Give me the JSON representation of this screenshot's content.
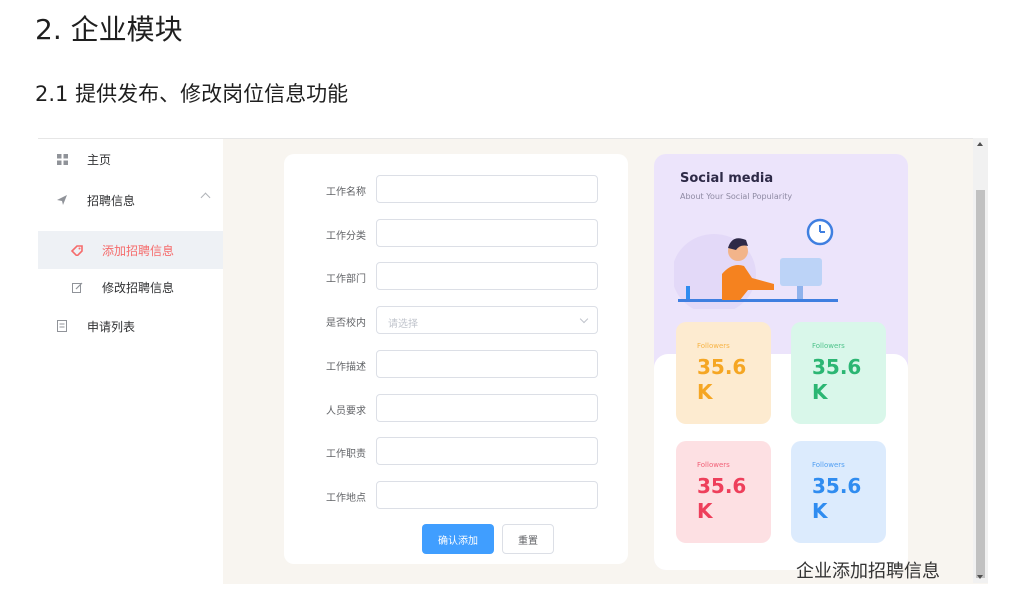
{
  "doc": {
    "heading": "2. 企业模块",
    "subheading": "2.1 提供发布、修改岗位信息功能",
    "caption": "企业添加招聘信息"
  },
  "sidebar": {
    "items": [
      {
        "label": "主页",
        "icon": "grid-icon"
      },
      {
        "label": "招聘信息",
        "icon": "send-icon"
      },
      {
        "label": "添加招聘信息",
        "icon": "tag-icon"
      },
      {
        "label": "修改招聘信息",
        "icon": "edit-icon"
      },
      {
        "label": "申请列表",
        "icon": "document-icon"
      }
    ]
  },
  "form": {
    "fields": [
      {
        "label": "工作名称",
        "value": ""
      },
      {
        "label": "工作分类",
        "value": ""
      },
      {
        "label": "工作部门",
        "value": ""
      },
      {
        "label": "是否校内",
        "placeholder": "请选择"
      },
      {
        "label": "工作描述",
        "value": ""
      },
      {
        "label": "人员要求",
        "value": ""
      },
      {
        "label": "工作职责",
        "value": ""
      },
      {
        "label": "工作地点",
        "value": ""
      }
    ],
    "submit_label": "确认添加",
    "reset_label": "重置"
  },
  "social": {
    "title": "Social media",
    "subtitle": "About Your Social Popularity",
    "tiles": [
      {
        "label": "Followers",
        "value": "35.6",
        "unit": "K",
        "color": "#f5a623",
        "bg": "#fdebd0"
      },
      {
        "label": "Followers",
        "value": "35.6",
        "unit": "K",
        "color": "#2bb673",
        "bg": "#d9f7ea"
      },
      {
        "label": "Followers",
        "value": "35.6",
        "unit": "K",
        "color": "#ee3f5b",
        "bg": "#fde0e3"
      },
      {
        "label": "Followers",
        "value": "35.6",
        "unit": "K",
        "color": "#2f8cf0",
        "bg": "#dcebfd"
      }
    ]
  },
  "colors": {
    "accent": "#409eff",
    "active_menu": "#f56c6c"
  }
}
